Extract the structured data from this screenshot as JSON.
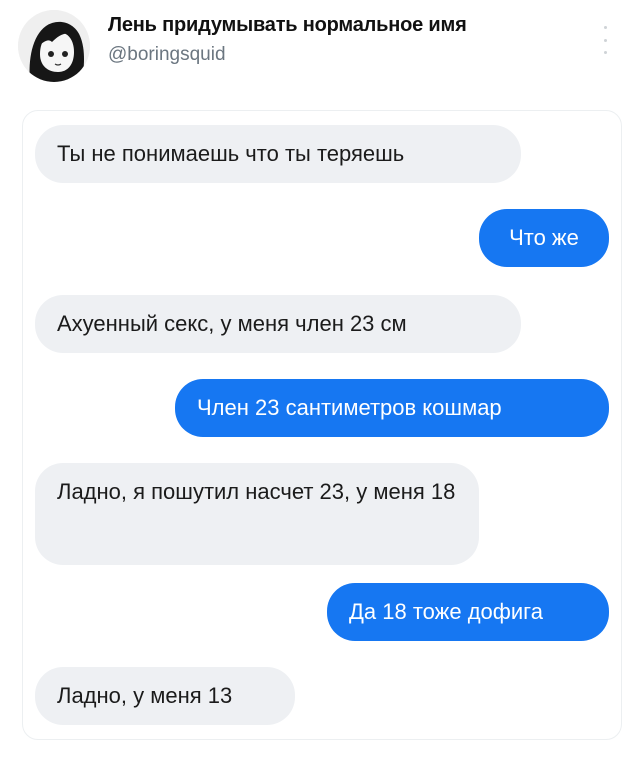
{
  "post": {
    "display_name": "Лень придумывать нормальное имя",
    "handle": "@boringsquid",
    "avatar_icon": "anime-avatar-icon",
    "more_icon": "more-options-icon"
  },
  "chat": {
    "colors": {
      "incoming_bg": "#eef0f3",
      "outgoing_bg": "#1677f2",
      "outgoing_text": "#ffffff"
    },
    "messages": [
      {
        "side": "incoming",
        "text": "Ты не понимаешь что ты теряешь"
      },
      {
        "side": "outgoing",
        "text": "Что же"
      },
      {
        "side": "incoming",
        "text": "Ахуенный секс, у меня член 23 см"
      },
      {
        "side": "outgoing",
        "text": "Член 23 сантиметров кошмар"
      },
      {
        "side": "incoming",
        "text": "Ладно, я пошутил насчет 23, у меня 18"
      },
      {
        "side": "outgoing",
        "text": "Да 18 тоже дофига"
      },
      {
        "side": "incoming",
        "text": "Ладно, у меня 13"
      }
    ]
  }
}
